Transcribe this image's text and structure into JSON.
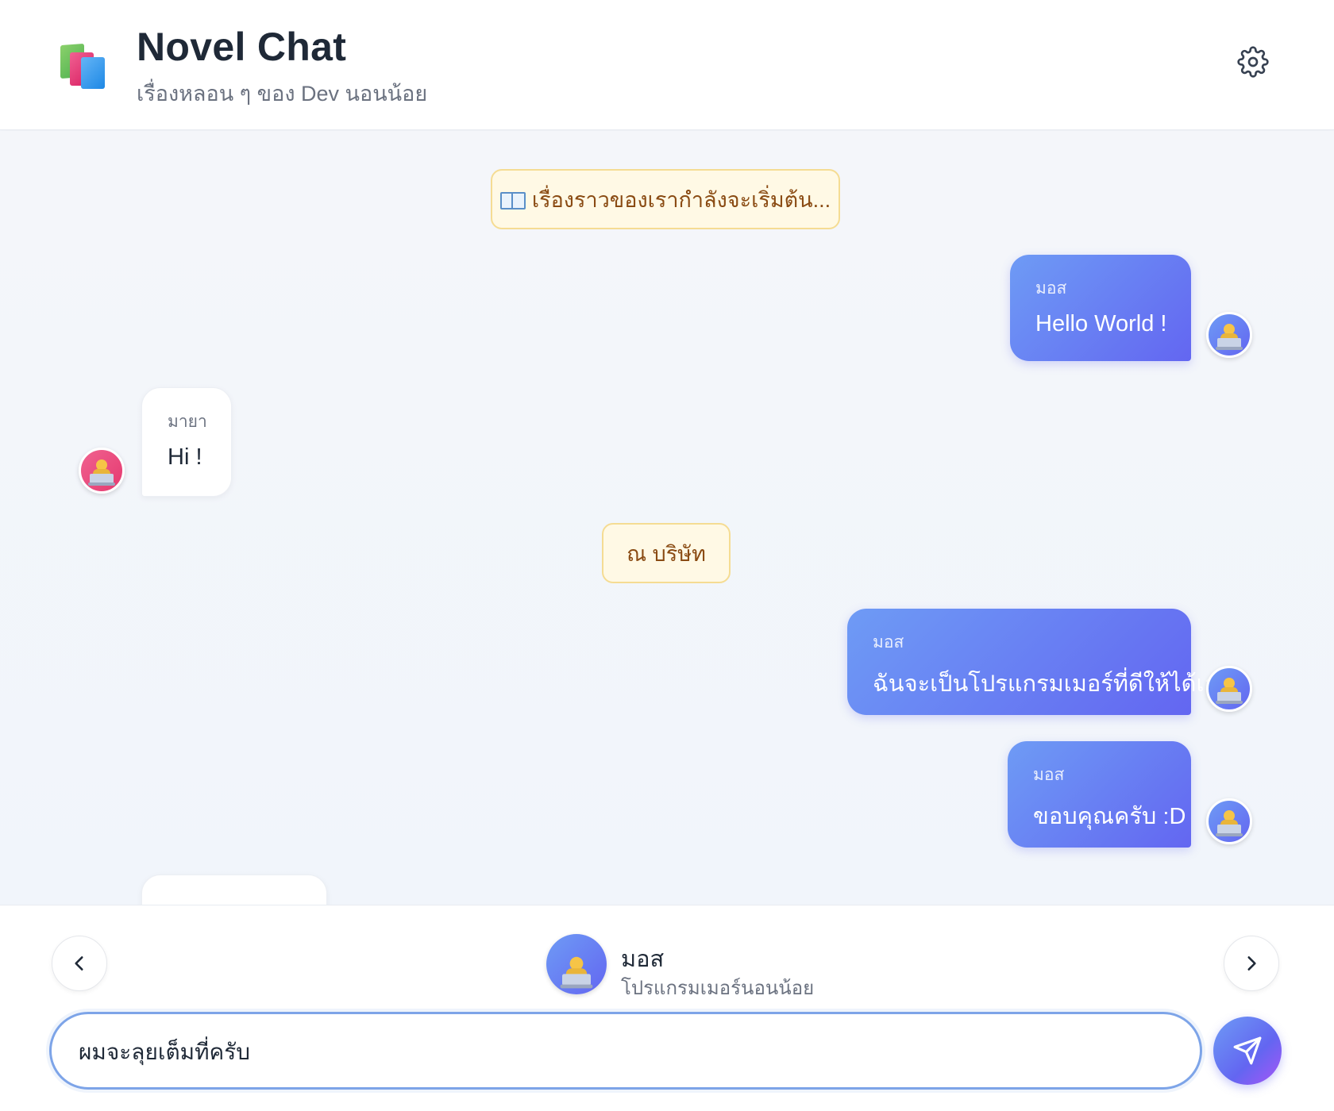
{
  "header": {
    "title": "Novel Chat",
    "subtitle": "เรื่องหลอน ๆ ของ Dev นอนน้อย",
    "logo_icon": "books-icon",
    "settings_icon": "gear-icon"
  },
  "chat": {
    "narration_1": "เรื่องราวของเรากำลังจะเริ่มต้น...",
    "narration_2": "ณ บริษัท",
    "messages": [
      {
        "sender": "มอส",
        "text": "Hello World !",
        "side": "right"
      },
      {
        "sender": "มายา",
        "text": "Hi !",
        "side": "left"
      },
      {
        "sender": "มอส",
        "text": "ฉันจะเป็นโปรแกรมเมอร์ที่ดีให้ได้เลย",
        "side": "right"
      },
      {
        "sender": "มอส",
        "text": "ขอบคุณครับ :D",
        "side": "right"
      }
    ]
  },
  "composer": {
    "character_name": "มอส",
    "character_role": "โปรแกรมเมอร์นอนน้อย",
    "input_value": "ผมจะลุยเต็มที่ครับ",
    "prev_icon": "chevron-left-icon",
    "next_icon": "chevron-right-icon",
    "send_icon": "send-icon"
  },
  "colors": {
    "accent_start": "#6e9bf5",
    "accent_end": "#6366f1",
    "narration_bg": "#fff9e5",
    "narration_text": "#8a4b13",
    "pink_avatar": "#e53970"
  }
}
